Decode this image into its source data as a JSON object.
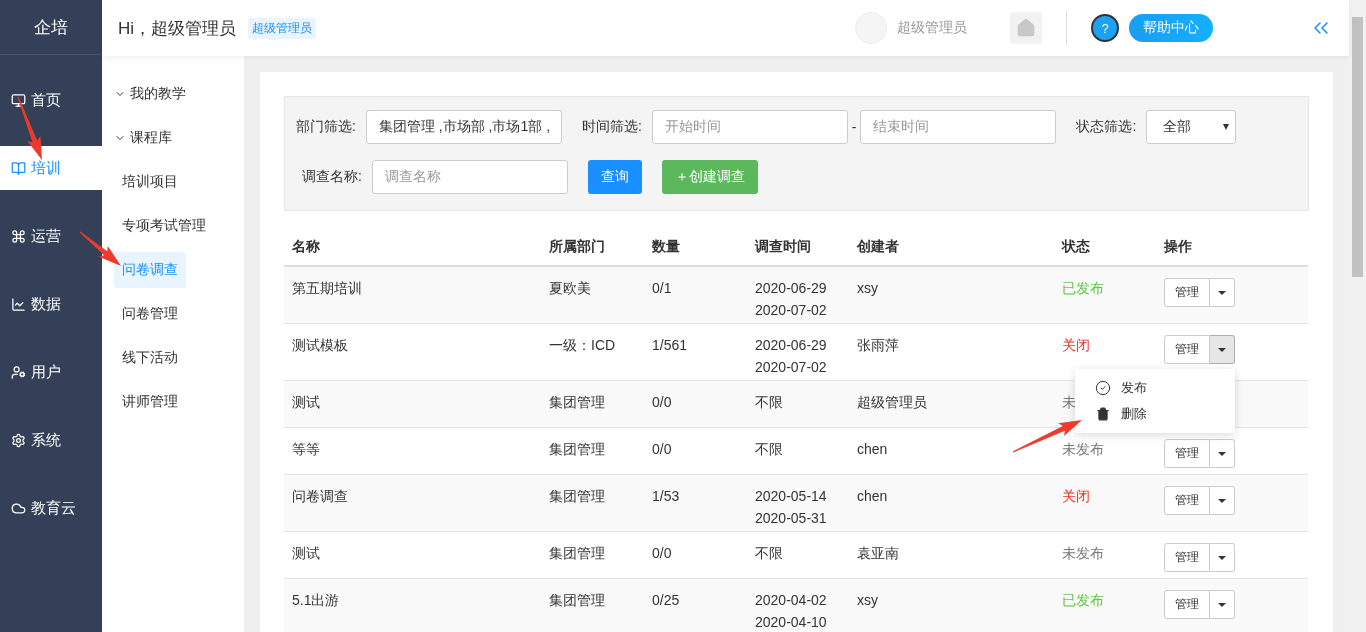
{
  "app": {
    "logo": "企培"
  },
  "nav": [
    {
      "label": "首页",
      "selected": false
    },
    {
      "label": "培训",
      "selected": true
    },
    {
      "label": "运营",
      "selected": false
    },
    {
      "label": "数据",
      "selected": false
    },
    {
      "label": "用户",
      "selected": false
    },
    {
      "label": "系统",
      "selected": false
    },
    {
      "label": "教育云",
      "selected": false
    }
  ],
  "header": {
    "greeting": "Hi，超级管理员",
    "role_badge": "超级管理员",
    "user_name": "超级管理员",
    "help_icon_text": "?",
    "help_label": "帮助中心"
  },
  "subnav": [
    {
      "label": "我的教学",
      "kind": "group",
      "selected": false
    },
    {
      "label": "课程库",
      "kind": "group",
      "selected": false
    },
    {
      "label": "培训项目",
      "kind": "link",
      "selected": false
    },
    {
      "label": "专项考试管理",
      "kind": "link",
      "selected": false
    },
    {
      "label": "问卷调查",
      "kind": "link",
      "selected": true
    },
    {
      "label": "问卷管理",
      "kind": "link",
      "selected": false
    },
    {
      "label": "线下活动",
      "kind": "link",
      "selected": false
    },
    {
      "label": "讲师管理",
      "kind": "link",
      "selected": false
    }
  ],
  "filters": {
    "dept_label": "部门筛选:",
    "dept_value": "集团管理 ,市场部 ,市场1部 ,",
    "time_label": "时间筛选:",
    "start_placeholder": "开始时间",
    "separator": "-",
    "end_placeholder": "结束时间",
    "status_label": "状态筛选:",
    "status_value": "全部",
    "name_label": "调查名称:",
    "name_placeholder": "调查名称",
    "query_button": "查询",
    "create_button": "＋创建调查"
  },
  "table": {
    "columns": [
      "名称",
      "所属部门",
      "数量",
      "调查时间",
      "创建者",
      "状态",
      "操作"
    ],
    "rows": [
      {
        "name": "第五期培训",
        "dept": "夏欧美",
        "count": "0/1",
        "time": [
          "2020-06-29",
          "2020-07-02"
        ],
        "creator": "xsy",
        "status": "已发布",
        "color": "#5cc93a",
        "action": "管理"
      },
      {
        "name": "测试模板",
        "dept": "一级：ICD",
        "count": "1/561",
        "time": [
          "2020-06-29",
          "2020-07-02"
        ],
        "creator": "张雨萍",
        "status": "关闭",
        "color": "#f0302a",
        "action": "管理",
        "menu": {
          "items": [
            {
              "label": "发布",
              "kind": "publish"
            },
            {
              "label": "删除",
              "kind": "delete"
            }
          ]
        }
      },
      {
        "name": "测试",
        "dept": "集团管理",
        "count": "0/0",
        "time": [
          "不限"
        ],
        "creator": "超级管理员",
        "status": "未",
        "color": "#777777"
      },
      {
        "name": "等等",
        "dept": "集团管理",
        "count": "0/0",
        "time": [
          "不限"
        ],
        "creator": "chen",
        "status": "未发布",
        "color": "#777777",
        "action": "管理"
      },
      {
        "name": "问卷调查",
        "dept": "集团管理",
        "count": "1/53",
        "time": [
          "2020-05-14",
          "2020-05-31"
        ],
        "creator": "chen",
        "status": "关闭",
        "color": "#f0302a",
        "action": "管理"
      },
      {
        "name": "测试",
        "dept": "集团管理",
        "count": "0/0",
        "time": [
          "不限"
        ],
        "creator": "袁亚南",
        "status": "未发布",
        "color": "#777777",
        "action": "管理"
      },
      {
        "name": "5.1出游",
        "dept": "集团管理",
        "count": "0/25",
        "time": [
          "2020-04-02",
          "2020-04-10"
        ],
        "creator": "xsy",
        "status": "已发布",
        "color": "#5cc93a",
        "action": "管理"
      }
    ]
  }
}
